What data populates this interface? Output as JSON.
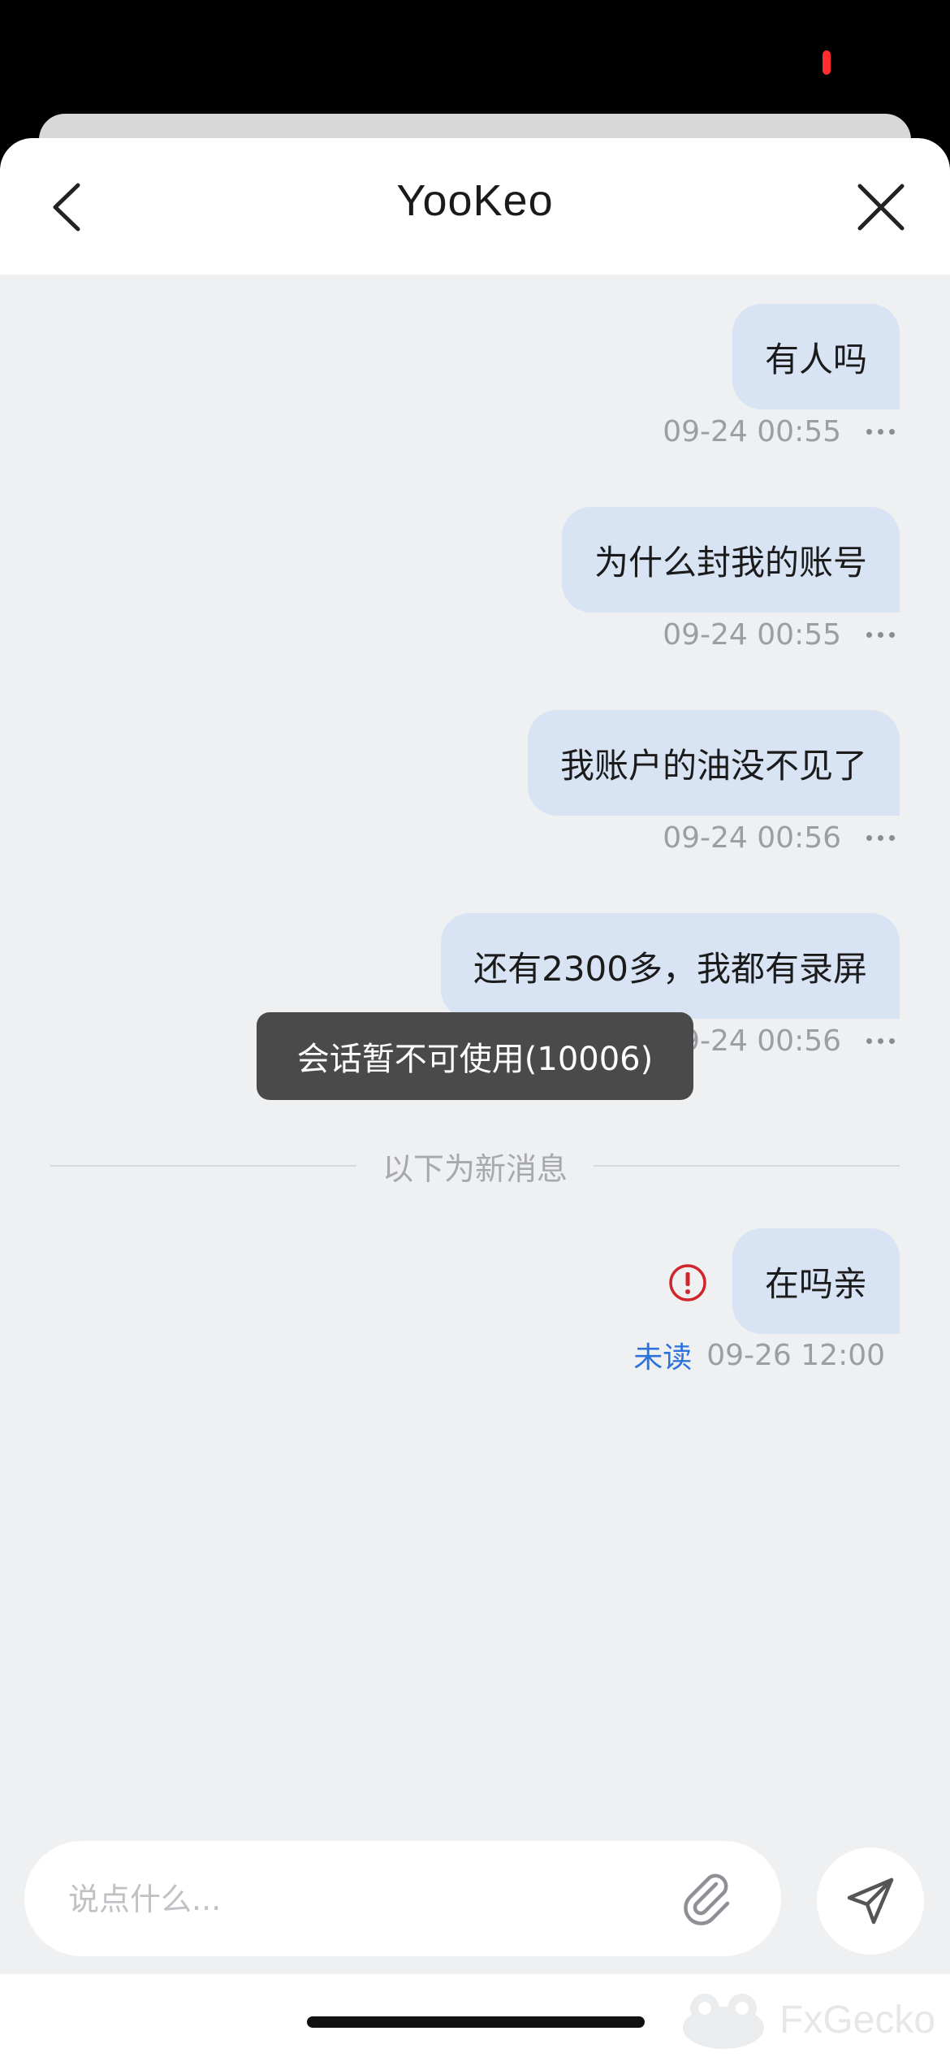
{
  "header": {
    "title": "YooKeo"
  },
  "messages": [
    {
      "text": "有人吗",
      "time": "09-24 00:55"
    },
    {
      "text": "为什么封我的账号",
      "time": "09-24 00:55"
    },
    {
      "text": "我账户的油没不见了",
      "time": "09-24 00:56"
    },
    {
      "text": "还有2300多，我都有录屏",
      "time": "09-24 00:56"
    }
  ],
  "toast": "会话暂不可使用(10006)",
  "divider": "以下为新消息",
  "new_message": {
    "text": "在吗亲",
    "status": "未读",
    "time": "09-26 12:00"
  },
  "composer": {
    "placeholder": "说点什么..."
  },
  "watermark": "FxGecko",
  "colors": {
    "bubble": "#d8e3f4",
    "error": "#d0262b",
    "unread": "#2c72d9",
    "background": "#eff0f2"
  }
}
